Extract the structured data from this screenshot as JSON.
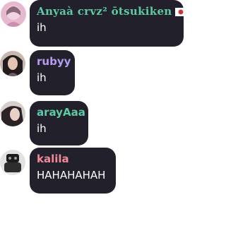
{
  "chat": {
    "messages": [
      {
        "username": "Anyaà crvz² ōtsukiken",
        "username_color": "#5fc9a6",
        "badge_icon": "japan-flag-icon",
        "text": "ih"
      },
      {
        "username": "rubyy",
        "username_color": "#b59cf0",
        "text": "ih"
      },
      {
        "username": "arayAaa",
        "username_color": "#5fc9a6",
        "text": "ih"
      },
      {
        "username": "kalila",
        "username_color": "#f08a9a",
        "text": "HAHAHAHAH"
      }
    ]
  }
}
